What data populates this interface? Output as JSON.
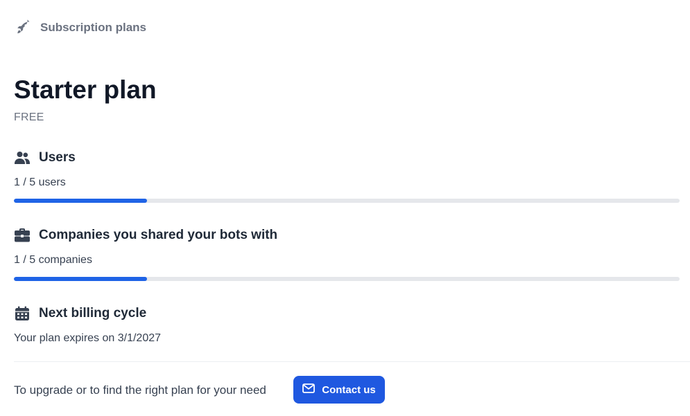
{
  "breadcrumb": {
    "icon": "rocket-icon",
    "label": "Subscription plans"
  },
  "plan": {
    "title": "Starter plan",
    "price": "FREE"
  },
  "usage": [
    {
      "key": "users",
      "icon": "users-icon",
      "title": "Users",
      "subtitle": "1 / 5 users",
      "used": 1,
      "limit": 5
    },
    {
      "key": "companies",
      "icon": "briefcase-icon",
      "title": "Companies you shared your bots with",
      "subtitle": "1 / 5 companies",
      "used": 1,
      "limit": 5
    }
  ],
  "billing": {
    "icon": "calendar-icon",
    "title": "Next billing cycle",
    "subtitle": "Your plan expires on 3/1/2027"
  },
  "footer": {
    "text": "To upgrade or to find the right plan for your need",
    "button_label": "Contact us",
    "button_icon": "mail-icon"
  },
  "colors": {
    "accent": "#1f58e0",
    "progress": "#1f63e6",
    "track": "#e5e7eb",
    "muted": "#6b7280"
  }
}
